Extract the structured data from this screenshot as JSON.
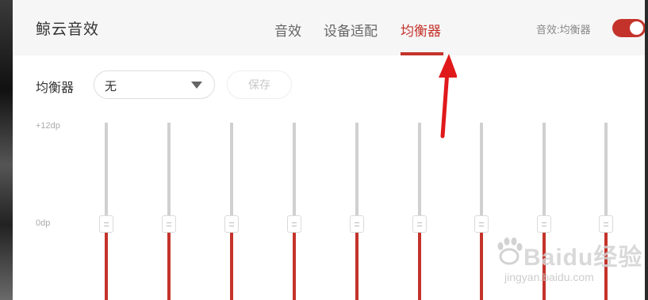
{
  "app": {
    "title": "鲸云音效"
  },
  "tabs": [
    {
      "label": "音效",
      "active": false
    },
    {
      "label": "设备适配",
      "active": false
    },
    {
      "label": "均衡器",
      "active": true
    }
  ],
  "effect_switch": {
    "label": "音效:均衡器",
    "on": true
  },
  "equalizer": {
    "label": "均衡器",
    "preset": "无",
    "save_label": "保存",
    "scale_top": "+12dp",
    "scale_mid": "0dp",
    "band_count": 9,
    "band_levels_db": [
      0,
      0,
      0,
      0,
      0,
      0,
      0,
      0,
      0
    ]
  },
  "watermark": {
    "brand": "Baidu经验",
    "url": "jingyan.baidu.com"
  },
  "colors": {
    "accent": "#c4332b",
    "track": "#d0d0d0",
    "header_bg": "#f6f6f6"
  }
}
